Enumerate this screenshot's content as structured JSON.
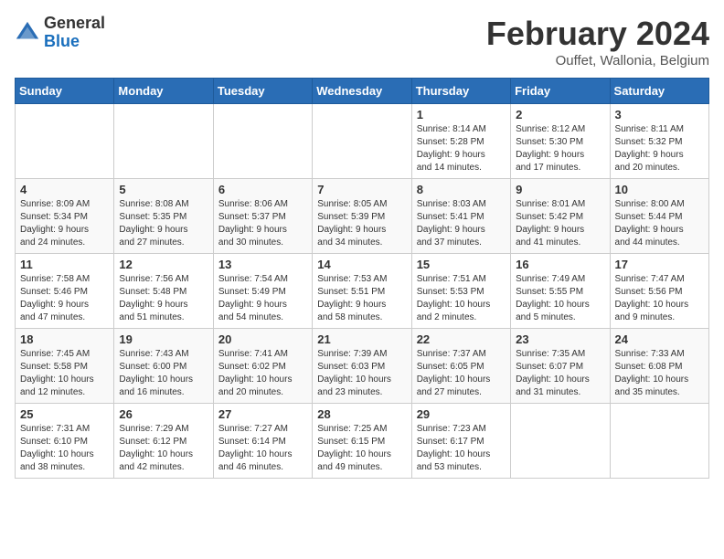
{
  "header": {
    "logo_general": "General",
    "logo_blue": "Blue",
    "month_title": "February 2024",
    "subtitle": "Ouffet, Wallonia, Belgium"
  },
  "columns": [
    "Sunday",
    "Monday",
    "Tuesday",
    "Wednesday",
    "Thursday",
    "Friday",
    "Saturday"
  ],
  "weeks": [
    [
      {
        "day": "",
        "info": ""
      },
      {
        "day": "",
        "info": ""
      },
      {
        "day": "",
        "info": ""
      },
      {
        "day": "",
        "info": ""
      },
      {
        "day": "1",
        "info": "Sunrise: 8:14 AM\nSunset: 5:28 PM\nDaylight: 9 hours\nand 14 minutes."
      },
      {
        "day": "2",
        "info": "Sunrise: 8:12 AM\nSunset: 5:30 PM\nDaylight: 9 hours\nand 17 minutes."
      },
      {
        "day": "3",
        "info": "Sunrise: 8:11 AM\nSunset: 5:32 PM\nDaylight: 9 hours\nand 20 minutes."
      }
    ],
    [
      {
        "day": "4",
        "info": "Sunrise: 8:09 AM\nSunset: 5:34 PM\nDaylight: 9 hours\nand 24 minutes."
      },
      {
        "day": "5",
        "info": "Sunrise: 8:08 AM\nSunset: 5:35 PM\nDaylight: 9 hours\nand 27 minutes."
      },
      {
        "day": "6",
        "info": "Sunrise: 8:06 AM\nSunset: 5:37 PM\nDaylight: 9 hours\nand 30 minutes."
      },
      {
        "day": "7",
        "info": "Sunrise: 8:05 AM\nSunset: 5:39 PM\nDaylight: 9 hours\nand 34 minutes."
      },
      {
        "day": "8",
        "info": "Sunrise: 8:03 AM\nSunset: 5:41 PM\nDaylight: 9 hours\nand 37 minutes."
      },
      {
        "day": "9",
        "info": "Sunrise: 8:01 AM\nSunset: 5:42 PM\nDaylight: 9 hours\nand 41 minutes."
      },
      {
        "day": "10",
        "info": "Sunrise: 8:00 AM\nSunset: 5:44 PM\nDaylight: 9 hours\nand 44 minutes."
      }
    ],
    [
      {
        "day": "11",
        "info": "Sunrise: 7:58 AM\nSunset: 5:46 PM\nDaylight: 9 hours\nand 47 minutes."
      },
      {
        "day": "12",
        "info": "Sunrise: 7:56 AM\nSunset: 5:48 PM\nDaylight: 9 hours\nand 51 minutes."
      },
      {
        "day": "13",
        "info": "Sunrise: 7:54 AM\nSunset: 5:49 PM\nDaylight: 9 hours\nand 54 minutes."
      },
      {
        "day": "14",
        "info": "Sunrise: 7:53 AM\nSunset: 5:51 PM\nDaylight: 9 hours\nand 58 minutes."
      },
      {
        "day": "15",
        "info": "Sunrise: 7:51 AM\nSunset: 5:53 PM\nDaylight: 10 hours\nand 2 minutes."
      },
      {
        "day": "16",
        "info": "Sunrise: 7:49 AM\nSunset: 5:55 PM\nDaylight: 10 hours\nand 5 minutes."
      },
      {
        "day": "17",
        "info": "Sunrise: 7:47 AM\nSunset: 5:56 PM\nDaylight: 10 hours\nand 9 minutes."
      }
    ],
    [
      {
        "day": "18",
        "info": "Sunrise: 7:45 AM\nSunset: 5:58 PM\nDaylight: 10 hours\nand 12 minutes."
      },
      {
        "day": "19",
        "info": "Sunrise: 7:43 AM\nSunset: 6:00 PM\nDaylight: 10 hours\nand 16 minutes."
      },
      {
        "day": "20",
        "info": "Sunrise: 7:41 AM\nSunset: 6:02 PM\nDaylight: 10 hours\nand 20 minutes."
      },
      {
        "day": "21",
        "info": "Sunrise: 7:39 AM\nSunset: 6:03 PM\nDaylight: 10 hours\nand 23 minutes."
      },
      {
        "day": "22",
        "info": "Sunrise: 7:37 AM\nSunset: 6:05 PM\nDaylight: 10 hours\nand 27 minutes."
      },
      {
        "day": "23",
        "info": "Sunrise: 7:35 AM\nSunset: 6:07 PM\nDaylight: 10 hours\nand 31 minutes."
      },
      {
        "day": "24",
        "info": "Sunrise: 7:33 AM\nSunset: 6:08 PM\nDaylight: 10 hours\nand 35 minutes."
      }
    ],
    [
      {
        "day": "25",
        "info": "Sunrise: 7:31 AM\nSunset: 6:10 PM\nDaylight: 10 hours\nand 38 minutes."
      },
      {
        "day": "26",
        "info": "Sunrise: 7:29 AM\nSunset: 6:12 PM\nDaylight: 10 hours\nand 42 minutes."
      },
      {
        "day": "27",
        "info": "Sunrise: 7:27 AM\nSunset: 6:14 PM\nDaylight: 10 hours\nand 46 minutes."
      },
      {
        "day": "28",
        "info": "Sunrise: 7:25 AM\nSunset: 6:15 PM\nDaylight: 10 hours\nand 49 minutes."
      },
      {
        "day": "29",
        "info": "Sunrise: 7:23 AM\nSunset: 6:17 PM\nDaylight: 10 hours\nand 53 minutes."
      },
      {
        "day": "",
        "info": ""
      },
      {
        "day": "",
        "info": ""
      }
    ]
  ]
}
